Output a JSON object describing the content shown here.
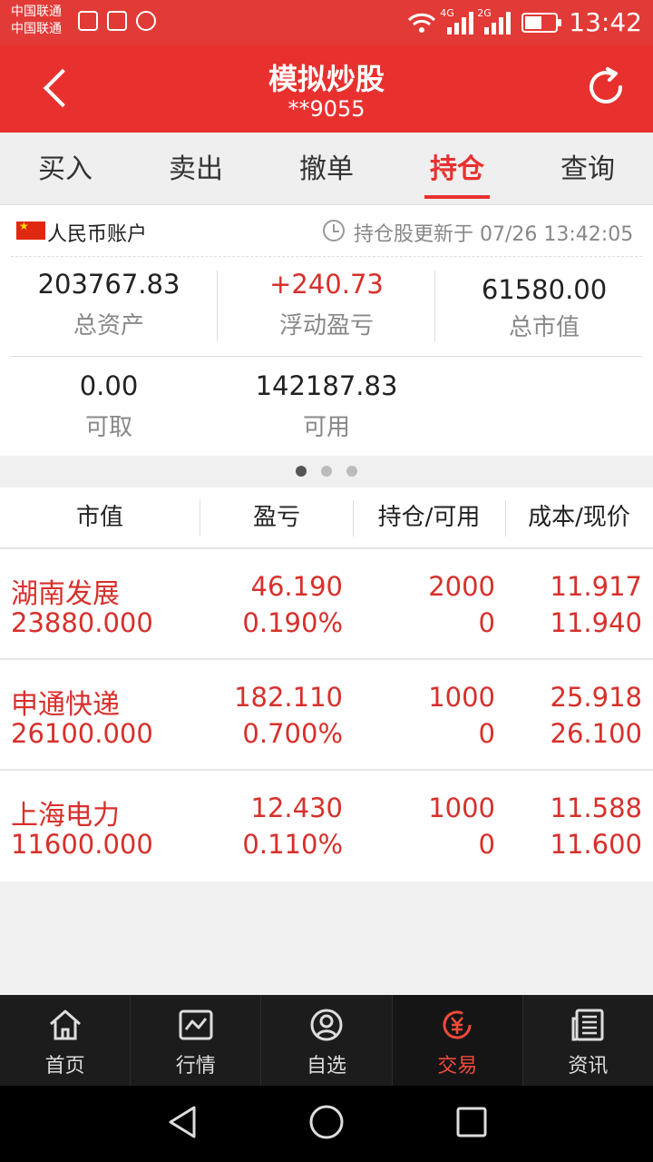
{
  "statusbar": {
    "carrier1": "中国联通",
    "carrier2": "中国联通",
    "net1": "4G",
    "net2": "2G",
    "time": "13:42"
  },
  "header": {
    "title": "模拟炒股",
    "subtitle": "**9055"
  },
  "tabs": [
    {
      "label": "买入"
    },
    {
      "label": "卖出"
    },
    {
      "label": "撤单"
    },
    {
      "label": "持仓",
      "active": true
    },
    {
      "label": "查询"
    }
  ],
  "account": {
    "label": "人民币账户",
    "updated": "持仓股更新于 07/26 13:42:05",
    "total_assets": {
      "value": "203767.83",
      "label": "总资产"
    },
    "floating_pl": {
      "value": "+240.73",
      "label": "浮动盈亏"
    },
    "market_value": {
      "value": "61580.00",
      "label": "总市值"
    },
    "withdrawable": {
      "value": "0.00",
      "label": "可取"
    },
    "available": {
      "value": "142187.83",
      "label": "可用"
    }
  },
  "table": {
    "headers": [
      "市值",
      "盈亏",
      "持仓/可用",
      "成本/现价"
    ],
    "rows": [
      {
        "name": "湖南发展",
        "market_value": "23880.000",
        "pl": "46.190",
        "pl_pct": "0.190%",
        "position": "2000",
        "available": "0",
        "cost": "11.917",
        "price": "11.940"
      },
      {
        "name": "申通快递",
        "market_value": "26100.000",
        "pl": "182.110",
        "pl_pct": "0.700%",
        "position": "1000",
        "available": "0",
        "cost": "25.918",
        "price": "26.100"
      },
      {
        "name": "上海电力",
        "market_value": "11600.000",
        "pl": "12.430",
        "pl_pct": "0.110%",
        "position": "1000",
        "available": "0",
        "cost": "11.588",
        "price": "11.600"
      }
    ]
  },
  "bottom_nav": [
    {
      "label": "首页",
      "icon": "home-icon"
    },
    {
      "label": "行情",
      "icon": "chart-icon"
    },
    {
      "label": "自选",
      "icon": "user-icon"
    },
    {
      "label": "交易",
      "icon": "yuan-icon",
      "active": true
    },
    {
      "label": "资讯",
      "icon": "news-icon"
    }
  ],
  "colors": {
    "brand_red": "#e8312f",
    "gain_red": "#d7302b",
    "active_nav": "#f04a3a"
  }
}
